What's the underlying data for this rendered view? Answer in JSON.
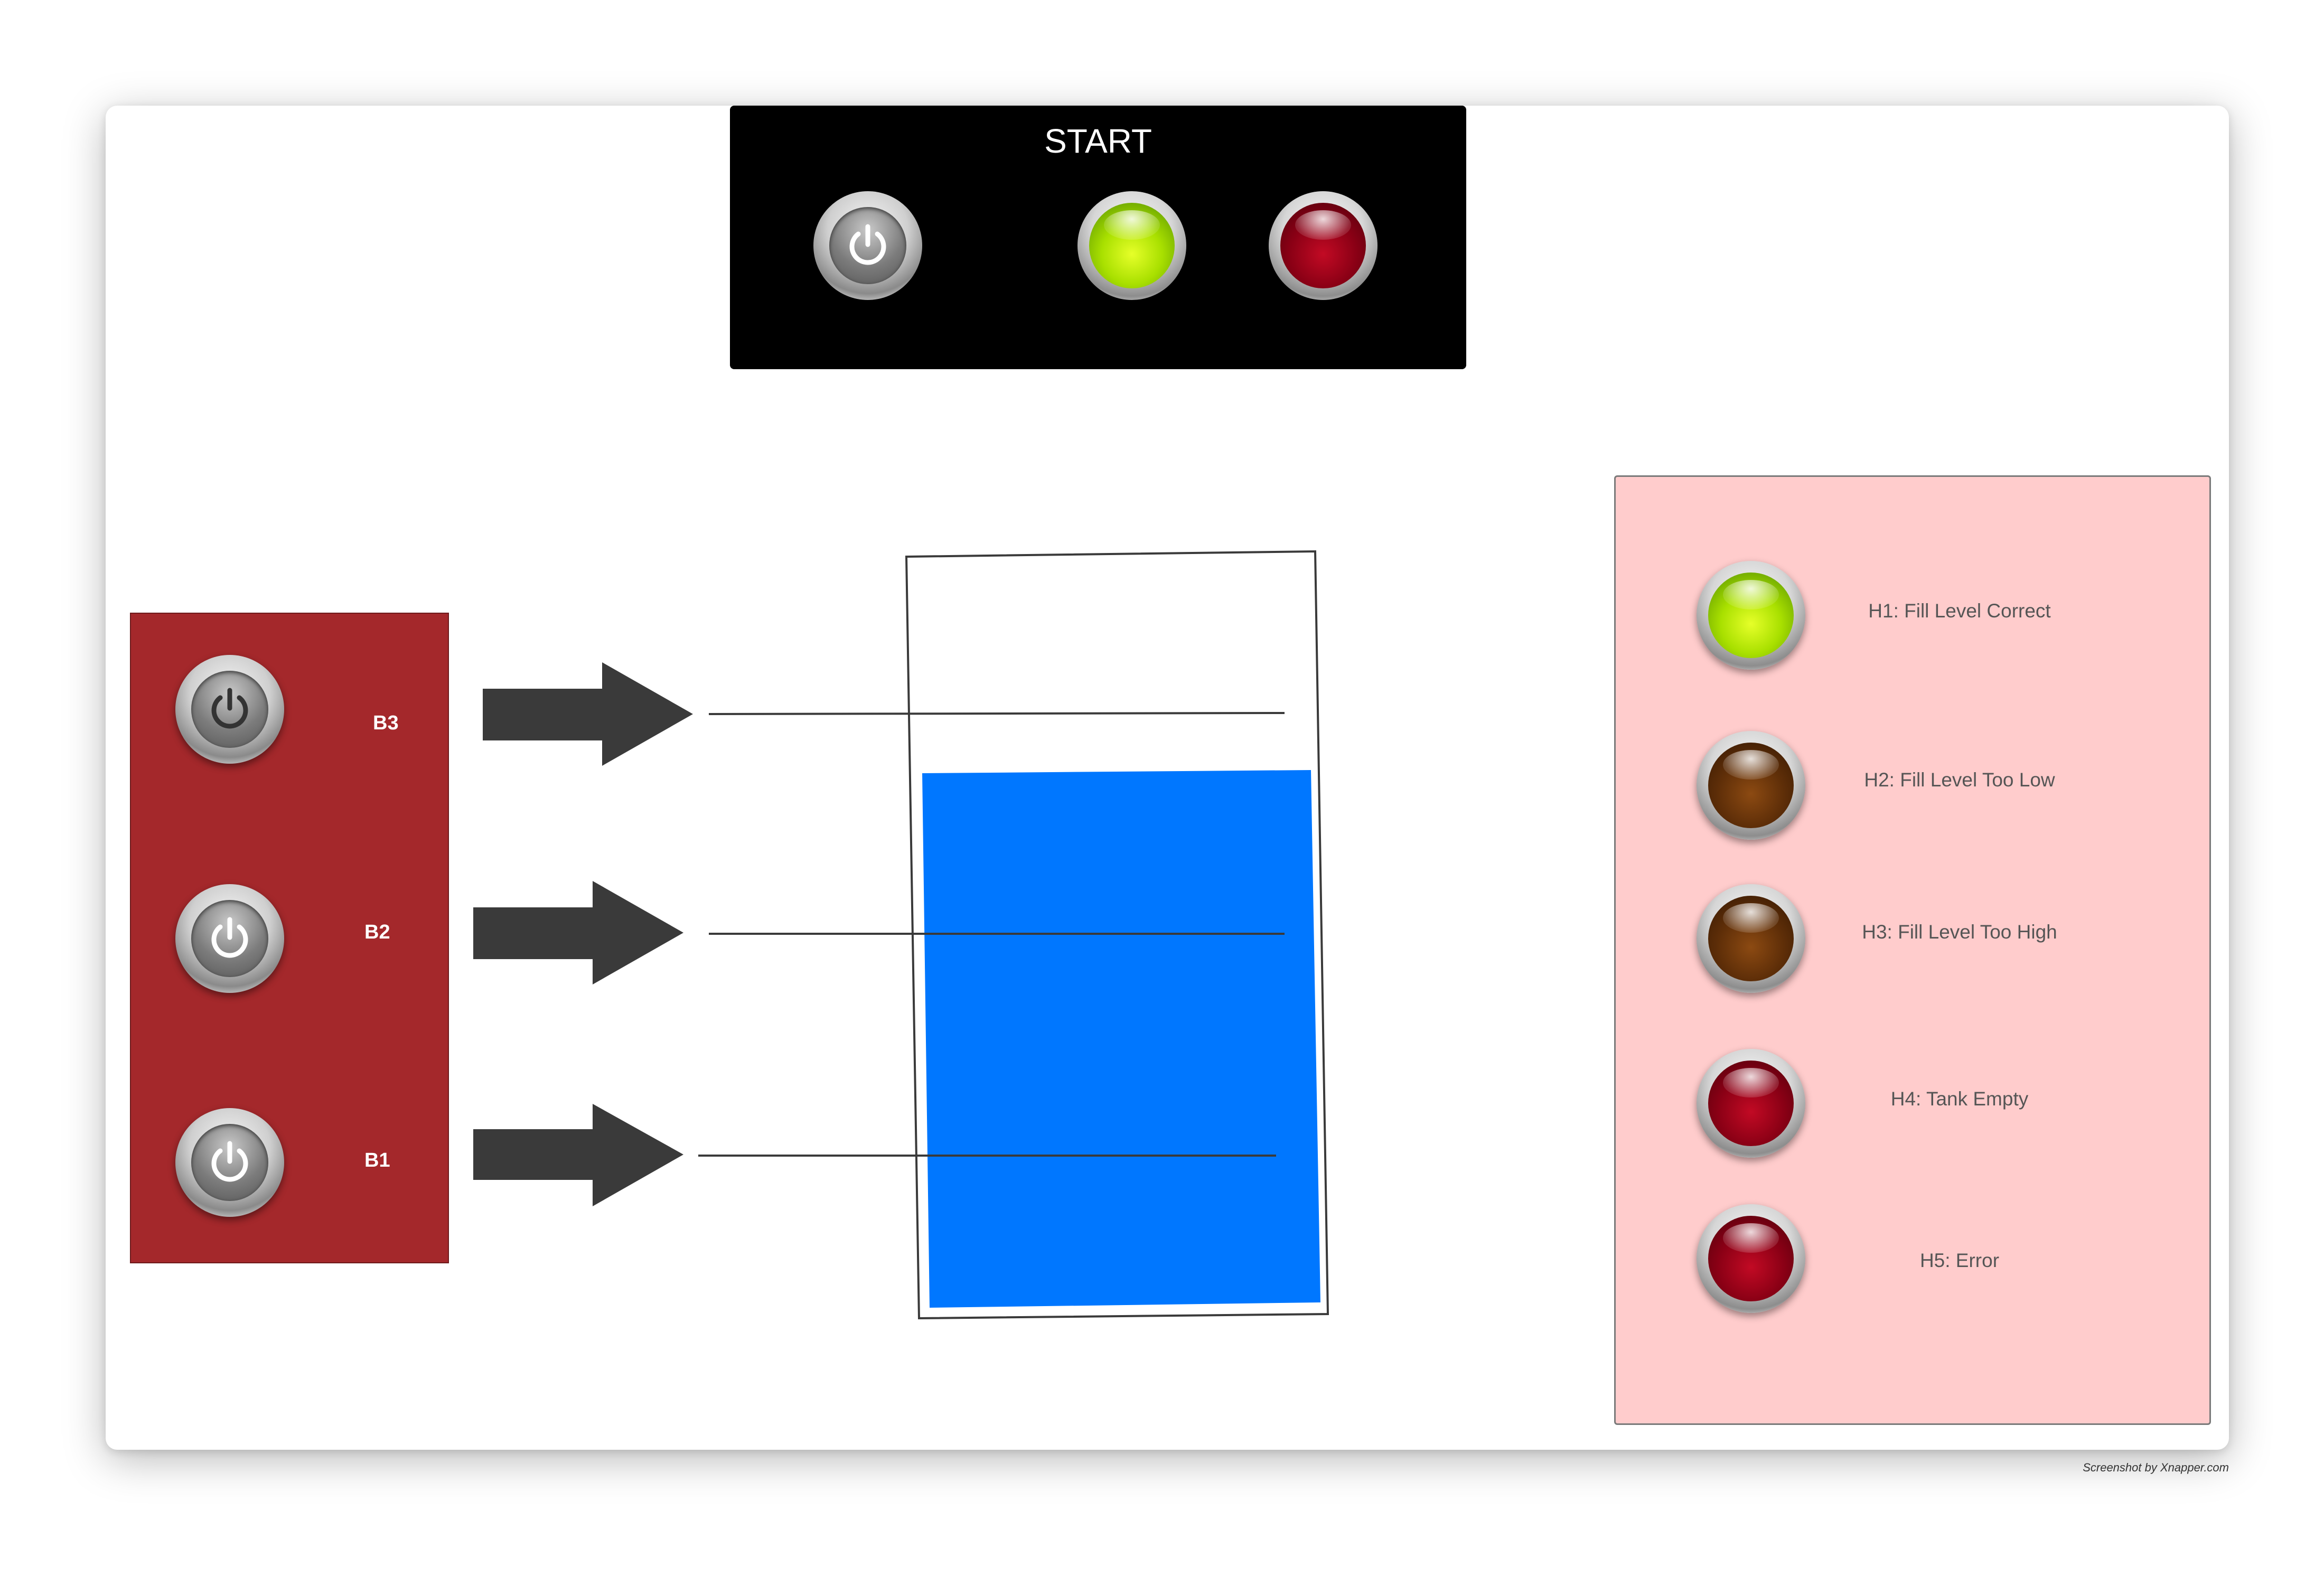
{
  "start_panel": {
    "title": "START"
  },
  "sensors": [
    {
      "label": "B3"
    },
    {
      "label": "B2"
    },
    {
      "label": "B1"
    }
  ],
  "indicators": [
    {
      "label": "H1: Fill Level Correct",
      "color": "#a9e000"
    },
    {
      "label": "H2: Fill Level Too Low",
      "color": "#5e2e08"
    },
    {
      "label": "H3: Fill Level Too High",
      "color": "#5e2e08"
    },
    {
      "label": "H4: Tank Empty",
      "color": "#8a0015"
    },
    {
      "label": "H5: Error",
      "color": "#8a0015"
    }
  ],
  "tank": {
    "fill_color": "#0077ff",
    "fill_fraction": 0.7
  },
  "footer": {
    "credit": "Screenshot by Xnapper.com"
  }
}
